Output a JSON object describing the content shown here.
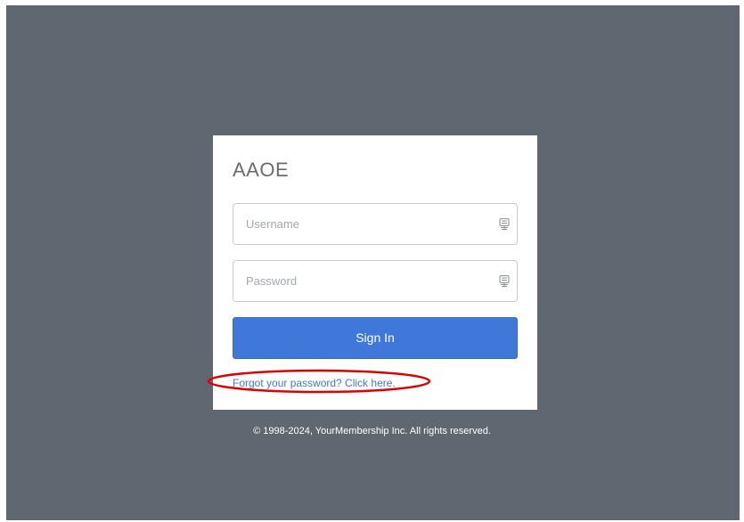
{
  "login": {
    "brand": "AAOE",
    "username_placeholder": "Username",
    "password_placeholder": "Password",
    "signin_label": "Sign In",
    "forgot_link": "Forgot your password? Click here.",
    "field_icon": "password-manager-key-icon"
  },
  "footer": {
    "copyright": "© 1998-2024, YourMembership Inc. All rights reserved."
  },
  "colors": {
    "backdrop": "#5f6870",
    "primary": "#3f78d8",
    "annotation": "#e00000"
  }
}
